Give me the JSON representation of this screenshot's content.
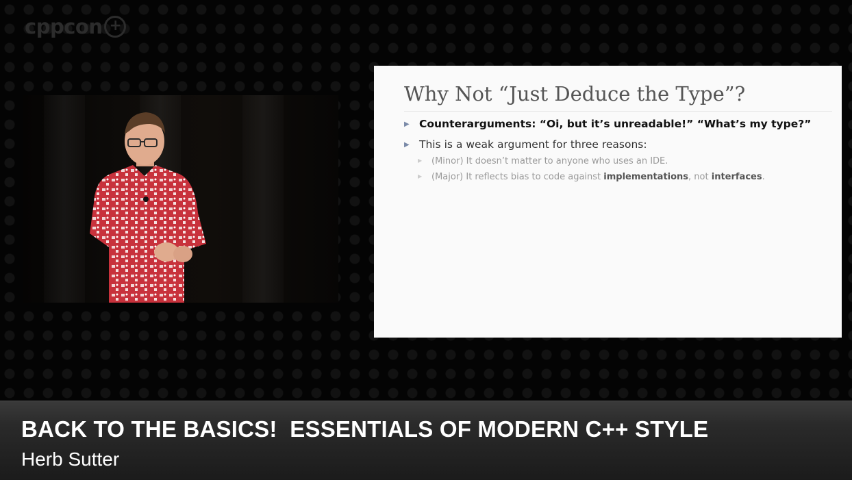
{
  "logo": {
    "text": "cppcon",
    "plus": "+"
  },
  "slide": {
    "title": "Why Not “Just Deduce the Type”?",
    "bullets": [
      {
        "text": "Counterarguments: “Oi, but it’s unreadable!” “What’s my type?”"
      },
      {
        "text": "This is a weak argument for three reasons:"
      },
      {
        "text": "(Minor) It doesn’t matter to anyone who uses an IDE."
      },
      {
        "prefix": "(Major) It reflects bias to code against ",
        "bold1": "implementations",
        "middle": ", not ",
        "bold2": "interfaces",
        "suffix": "."
      }
    ]
  },
  "lower_third": {
    "title": "BACK TO THE BASICS!  ESSENTIALS OF MODERN C++ STYLE",
    "speaker": "Herb Sutter"
  },
  "icons": {
    "bullet_marker": "triangle-right-icon"
  },
  "colors": {
    "slide_bg": "#fafafa",
    "lower_third_bg": "#2a2a2a",
    "page_bg": "#000000"
  }
}
